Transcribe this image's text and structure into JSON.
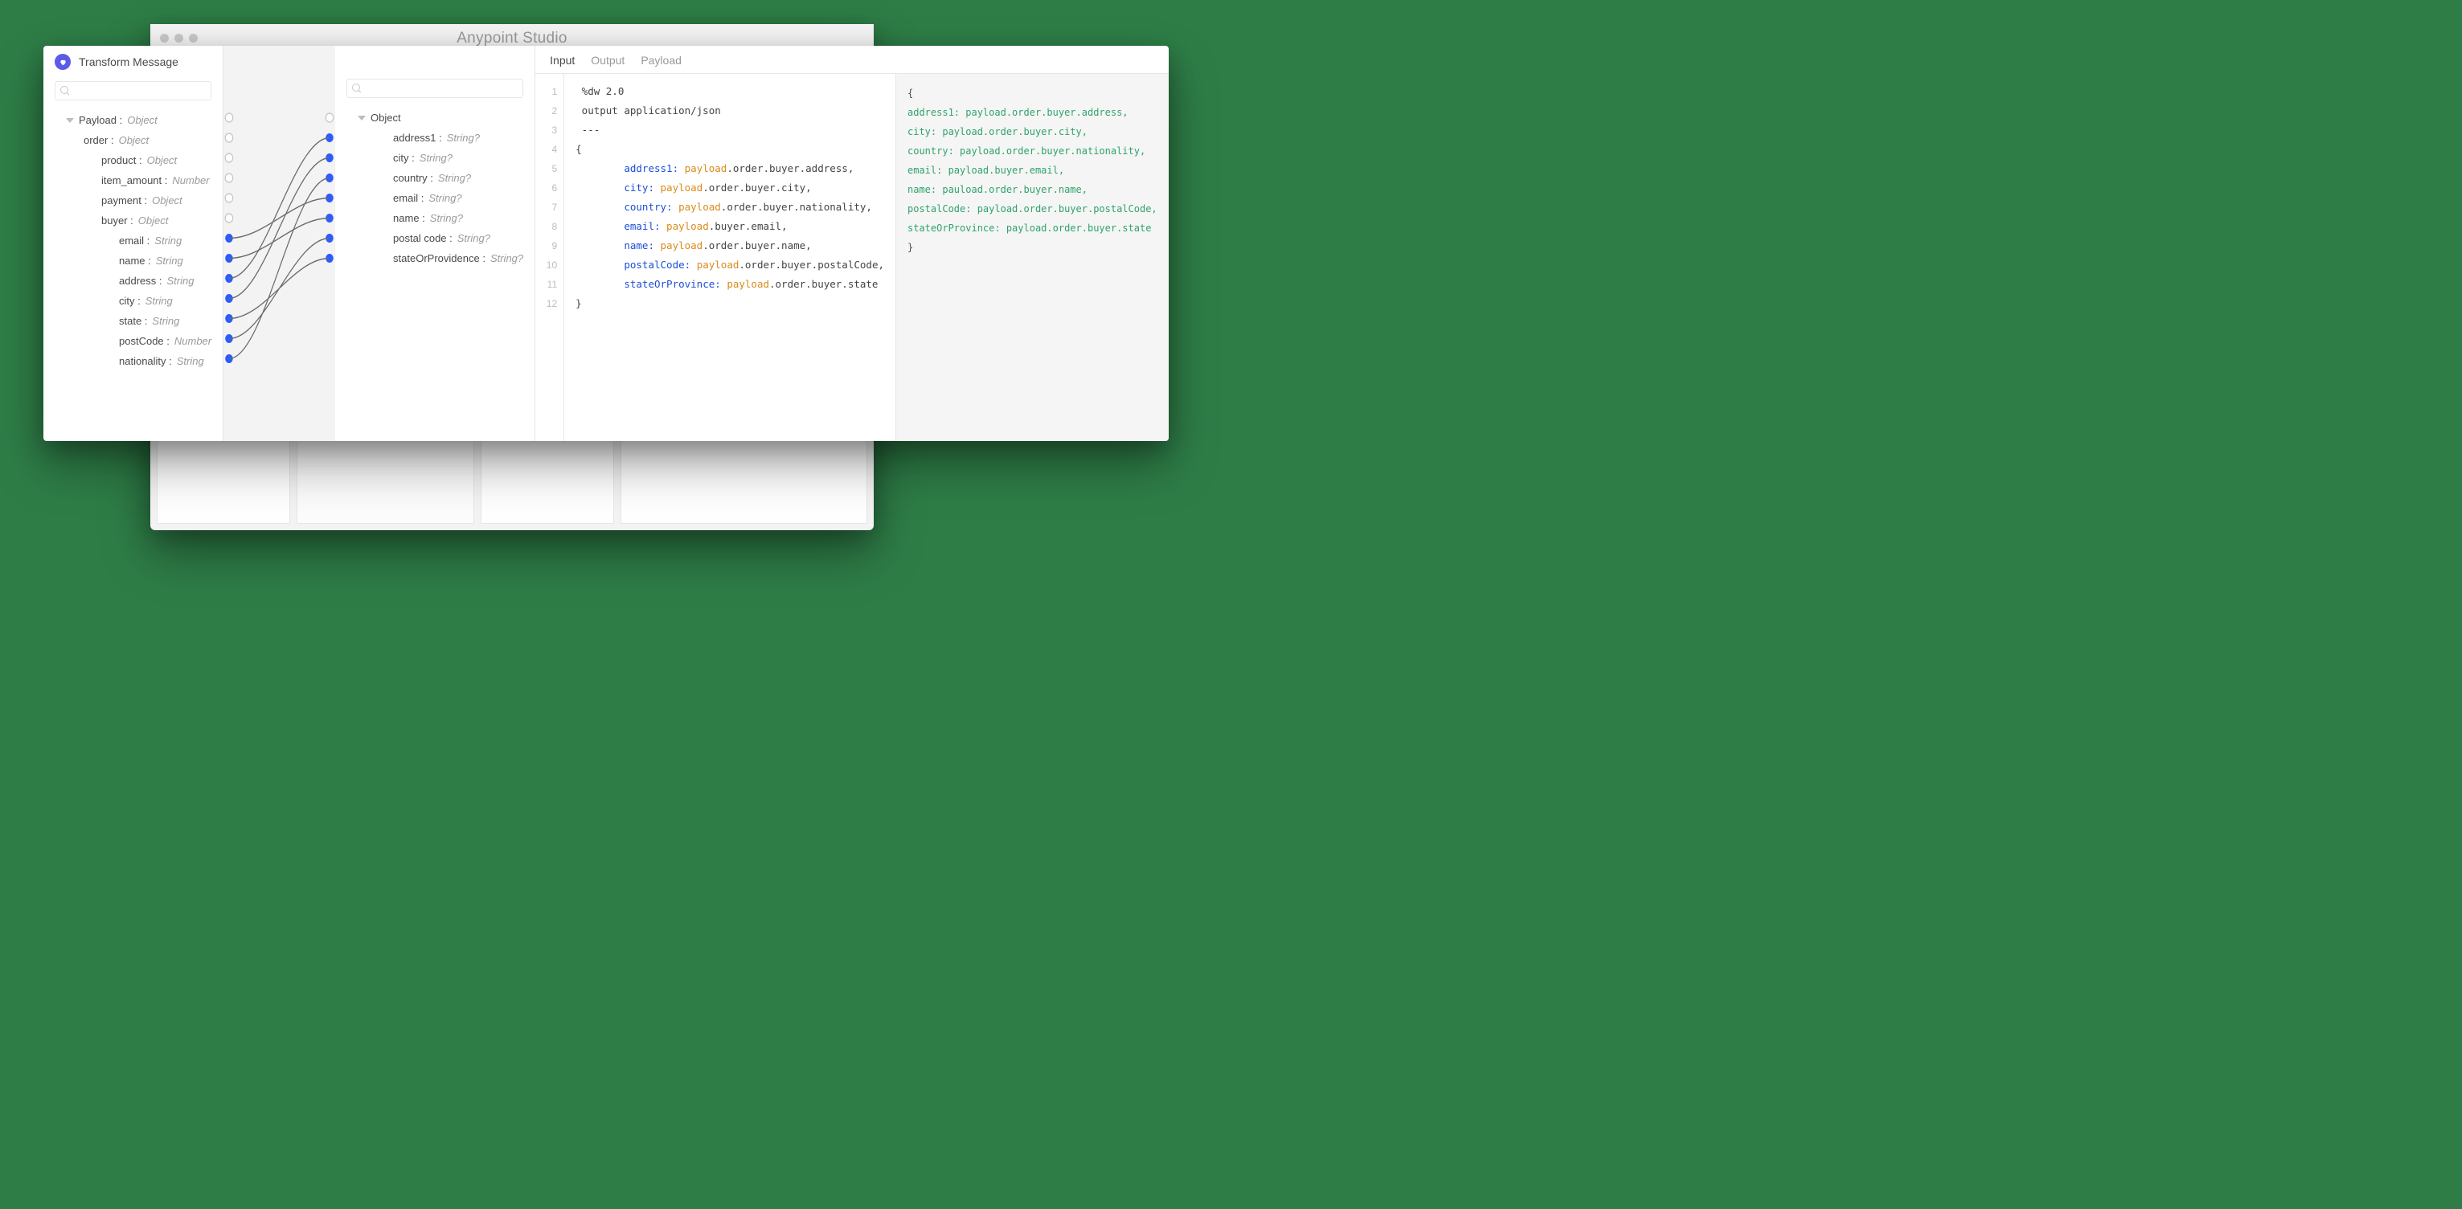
{
  "window": {
    "title": "Anypoint Studio"
  },
  "panel": {
    "title": "Transform Message"
  },
  "tabs": {
    "input": "Input",
    "output": "Output",
    "payload": "Payload",
    "active": "input"
  },
  "source_tree": {
    "root": {
      "name": "Payload",
      "type": "Object"
    },
    "order": {
      "name": "order",
      "type": "Object"
    },
    "product": {
      "name": "product",
      "type": "Object"
    },
    "item_amount": {
      "name": "item_amount",
      "type": "Number"
    },
    "payment": {
      "name": "payment",
      "type": "Object"
    },
    "buyer": {
      "name": "buyer",
      "type": "Object"
    },
    "email": {
      "name": "email",
      "type": "String"
    },
    "name_field": {
      "name": "name",
      "type": "String"
    },
    "address": {
      "name": "address",
      "type": "String"
    },
    "city": {
      "name": "city",
      "type": "String"
    },
    "state": {
      "name": "state",
      "type": "String"
    },
    "postCode": {
      "name": "postCode",
      "type": "Number"
    },
    "nationality": {
      "name": "nationality",
      "type": "String"
    }
  },
  "target_tree": {
    "root": {
      "name": "Object"
    },
    "address1": {
      "name": "address1",
      "type": "String?"
    },
    "city": {
      "name": "city",
      "type": "String?"
    },
    "country": {
      "name": "country",
      "type": "String?"
    },
    "email": {
      "name": "email",
      "type": "String?"
    },
    "name_field": {
      "name": "name",
      "type": "String?"
    },
    "postal_code": {
      "name": "postal code",
      "type": "String?"
    },
    "stateOrProvidence": {
      "name": "stateOrProvidence",
      "type": "String?"
    }
  },
  "code": {
    "l1": "%dw 2.0",
    "l2": "output application/json",
    "l3": "---",
    "l4": "{",
    "pairs": [
      {
        "key": "address1",
        "path": ".order.buyer.address,"
      },
      {
        "key": "city",
        "path": ".order.buyer.city,"
      },
      {
        "key": "country",
        "path": ".order.buyer.nationality,"
      },
      {
        "key": "email",
        "path": ".buyer.email,"
      },
      {
        "key": "name",
        "path": ".order.buyer.name,"
      },
      {
        "key": "postalCode",
        "path": ".order.buyer.postalCode,"
      },
      {
        "key": "stateOrProvince",
        "path": ".order.buyer.state"
      }
    ],
    "close": "}"
  },
  "preview": {
    "open": "{",
    "lines": [
      "address1: payload.order.buyer.address,",
      "city: payload.order.buyer.city,",
      "country: payload.order.buyer.nationality,",
      "email: payload.buyer.email,",
      "name: pauload.order.buyer.name,",
      "postalCode: payload.order.buyer.postalCode,",
      "stateOrProvince: payload.order.buyer.state"
    ],
    "close": "}"
  },
  "mappings": [
    {
      "from": "email",
      "to": "email"
    },
    {
      "from": "name_field",
      "to": "name_field"
    },
    {
      "from": "address",
      "to": "address1"
    },
    {
      "from": "city",
      "to": "city"
    },
    {
      "from": "state",
      "to": "stateOrProvidence"
    },
    {
      "from": "postCode",
      "to": "postal_code"
    },
    {
      "from": "nationality",
      "to": "country"
    }
  ],
  "colors": {
    "brand_blue": "#2a5cff",
    "violet": "#5b5be6",
    "code_green": "#2fa36b"
  }
}
